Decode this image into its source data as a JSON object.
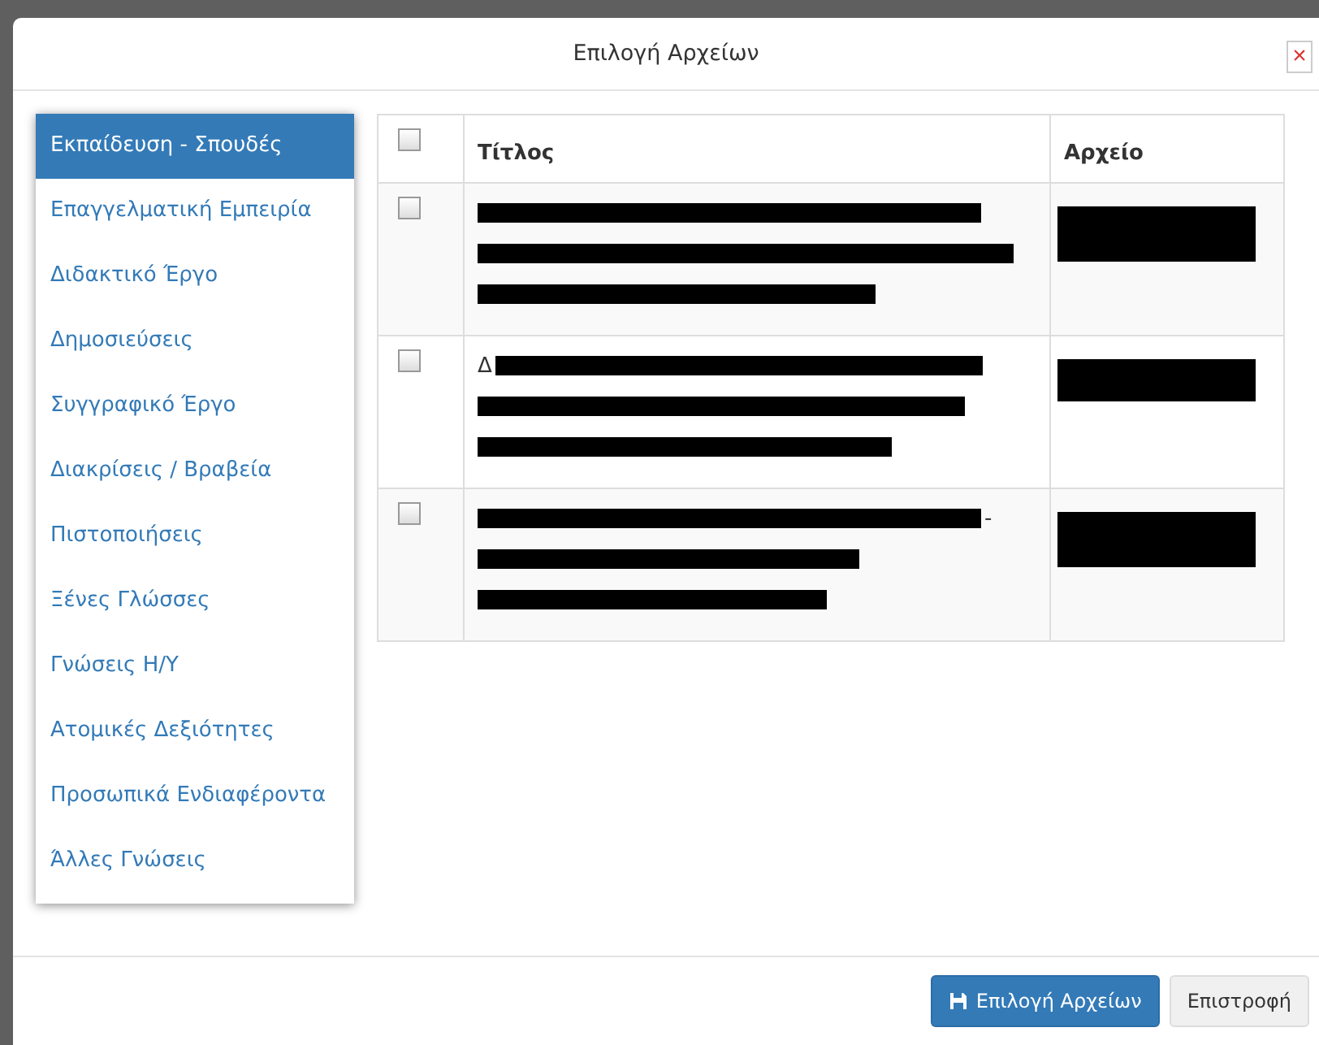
{
  "dialog": {
    "title": "Επιλογή Αρχείων",
    "close": "×"
  },
  "sidebar": {
    "items": [
      {
        "label": "Εκπαίδευση - Σπουδές",
        "selected": true
      },
      {
        "label": "Επαγγελματική Εμπειρία",
        "selected": false
      },
      {
        "label": "Διδακτικό Έργο",
        "selected": false
      },
      {
        "label": "Δημοσιεύσεις",
        "selected": false
      },
      {
        "label": "Συγγραφικό Έργο",
        "selected": false
      },
      {
        "label": "Διακρίσεις / Βραβεία",
        "selected": false
      },
      {
        "label": "Πιστοποιήσεις",
        "selected": false
      },
      {
        "label": "Ξένες Γλώσσες",
        "selected": false
      },
      {
        "label": "Γνώσεις Η/Υ",
        "selected": false
      },
      {
        "label": "Ατομικές Δεξιότητες",
        "selected": false
      },
      {
        "label": "Προσωπικά Ενδιαφέροντα",
        "selected": false
      },
      {
        "label": "Άλλες Γνώσεις",
        "selected": false
      }
    ]
  },
  "table": {
    "header_checked": false,
    "columns": [
      "Τίτλος",
      "Αρχείο"
    ],
    "rows": [
      {
        "checked": false
      },
      {
        "checked": false,
        "title_visible": "Δ"
      },
      {
        "checked": false,
        "title_visible": "-"
      }
    ]
  },
  "buttons": [
    {
      "kind": "primary",
      "label": "Επιλογή Αρχείων"
    },
    {
      "kind": "default",
      "label": "Επιστροφή"
    }
  ]
}
